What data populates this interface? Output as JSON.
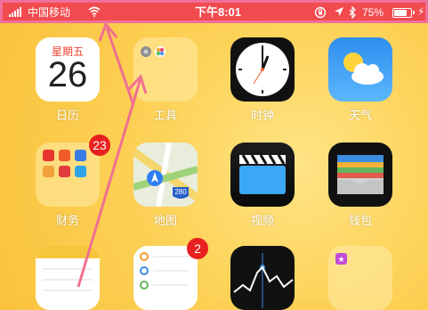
{
  "status_bar": {
    "carrier": "中国移动",
    "time": "下午8:01",
    "battery_percent": "75%",
    "battery_level": 0.75,
    "icons": [
      "signal-icon",
      "wifi-icon",
      "rotation-lock-icon",
      "location-icon",
      "bluetooth-icon",
      "battery-icon",
      "charging-icon"
    ]
  },
  "calendar": {
    "weekday": "星期五",
    "day": "26"
  },
  "apps": {
    "calendar": {
      "label": "日历"
    },
    "tools": {
      "label": "工具"
    },
    "clock": {
      "label": "时钟"
    },
    "weather": {
      "label": "天气"
    },
    "finance": {
      "label": "财务",
      "badge": "23"
    },
    "maps": {
      "label": "地图",
      "shield": "280"
    },
    "videos": {
      "label": "视频"
    },
    "wallet": {
      "label": "钱包"
    },
    "reminders": {
      "badge": "2"
    }
  },
  "colors": {
    "status_bar": "#f14a4f",
    "status_border": "#f06f9b",
    "arrow": "#f07090",
    "badge": "#e8201f"
  }
}
